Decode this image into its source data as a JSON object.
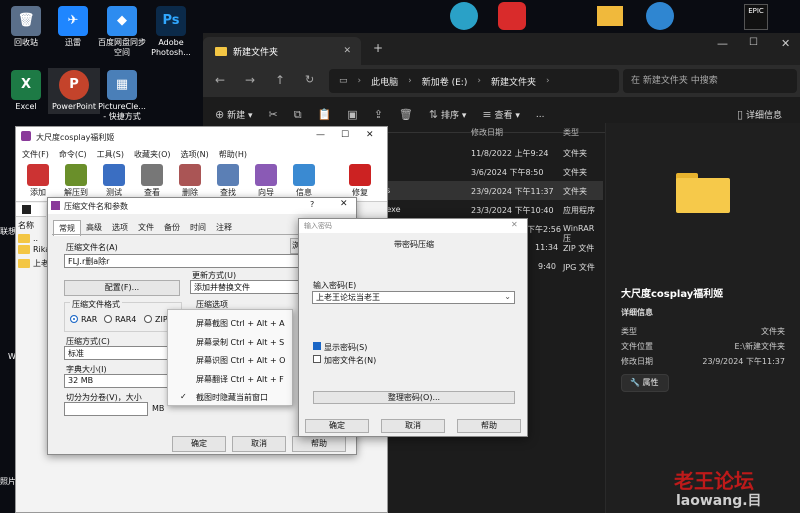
{
  "desktop": {
    "icons": [
      {
        "label": "回收站",
        "glyph": "🗑",
        "color": "#5a6f8a"
      },
      {
        "label": "迅雷",
        "glyph": "✈",
        "color": "#1f86ff"
      },
      {
        "label": "百度网盘同步空间",
        "glyph": "◆",
        "color": "#2d8cf0"
      },
      {
        "label": "Adobe Photosh...",
        "glyph": "Ps",
        "color": "#0b2a49"
      },
      {
        "label": "Excel",
        "glyph": "X",
        "color": "#1d7a45"
      },
      {
        "label": "PowerPoint",
        "glyph": "P",
        "color": "#c4432b"
      },
      {
        "label": "PictureCle... - 快捷方式",
        "glyph": "▦",
        "color": "#4a7fb8"
      }
    ],
    "partial_labels": [
      "联想",
      "W",
      "照片"
    ]
  },
  "explorer": {
    "tab_title": "新建文件夹",
    "breadcrumb": [
      "此电脑",
      "新加卷 (E:)",
      "新建文件夹"
    ],
    "search_placeholder": "在 新建文件夹 中搜索",
    "toolbar": {
      "new": "新建",
      "sort": "排序",
      "view": "查看",
      "more": "...",
      "details": "详细信息"
    },
    "columns": {
      "date": "修改日期",
      "type": "类型"
    },
    "rows": [
      {
        "name": "",
        "date": "11/8/2022 上午9:24",
        "type": "文件夹"
      },
      {
        "name": "",
        "date": "3/6/2024 下午8:50",
        "type": "文件夹"
      },
      {
        "name": "s",
        "date": "23/9/2024 下午11:37",
        "type": "文件夹"
      },
      {
        "name": "aller.exe",
        "date": "23/3/2024 下午10:40",
        "type": "应用程序"
      },
      {
        "name": "",
        "date": "下午2:56",
        "type": "WinRAR 压"
      },
      {
        "name": "",
        "date": "11:34",
        "type": "ZIP 文件"
      },
      {
        "name": "",
        "date": "9:40",
        "type": "JPG 文件"
      }
    ],
    "details_pane": {
      "title": "大尺度cosplay福利姬",
      "section": "详细信息",
      "fields": [
        {
          "key": "类型",
          "value": "文件夹"
        },
        {
          "key": "文件位置",
          "value": "E:\\新建文件夹"
        },
        {
          "key": "修改日期",
          "value": "23/9/2024 下午11:37"
        }
      ],
      "properties_button": "属性"
    }
  },
  "winrar": {
    "title": "大尺度cosplay福利姬",
    "menu": [
      "文件(F)",
      "命令(C)",
      "工具(S)",
      "收藏夹(O)",
      "选项(N)",
      "帮助(H)"
    ],
    "tools": [
      {
        "label": "添加",
        "color": "#c33"
      },
      {
        "label": "解压到",
        "color": "#6a8f2a"
      },
      {
        "label": "测试",
        "color": "#3a6ec2"
      },
      {
        "label": "查看",
        "color": "#777"
      },
      {
        "label": "删除",
        "color": "#a55"
      },
      {
        "label": "查找",
        "color": "#5b7fb5"
      },
      {
        "label": "向导",
        "color": "#8a5ab5"
      },
      {
        "label": "信息",
        "color": "#3a8ad2"
      },
      {
        "label": "修复",
        "color": "#c22"
      }
    ],
    "list_header": "名称",
    "list_items": [
      "..",
      "Rikac",
      "上老王"
    ]
  },
  "compress": {
    "title": "压缩文件名和参数",
    "help_mark": "?",
    "tabs": [
      "常规",
      "高级",
      "选项",
      "文件",
      "备份",
      "时间",
      "注释"
    ],
    "archive_name_label": "压缩文件名(A)",
    "archive_name_value": "FLJ.r删a除r",
    "browse_button": "浏",
    "profile_button": "配置(F)...",
    "update_mode_label": "更新方式(U)",
    "update_mode_value": "添加并替换文件",
    "format_label": "压缩文件格式",
    "formats": [
      "RAR",
      "RAR4",
      "ZIP"
    ],
    "options_label": "压缩选项",
    "method_label": "压缩方式(C)",
    "method_value": "标准",
    "dict_label": "字典大小(I)",
    "dict_value": "32 MB",
    "split_label": "切分为分卷(V)，大小",
    "split_unit": "MB",
    "ok": "确定",
    "cancel": "取消",
    "help": "帮助"
  },
  "context_menu": {
    "items": [
      "屏幕截图 Ctrl + Alt + A",
      "屏幕录制 Ctrl + Alt + S",
      "屏幕识图 Ctrl + Alt + O",
      "屏幕翻译 Ctrl + Alt + F",
      "截图时隐藏当前窗口"
    ],
    "check_mark": "✓"
  },
  "password": {
    "title": "输入密码",
    "heading": "带密码压缩",
    "input_label": "输入密码(E)",
    "input_value": "上老王论坛当老王",
    "show_password": "显示密码(S)",
    "encrypt_names": "加密文件名(N)",
    "organize_button": "整理密码(O)...",
    "ok": "确定",
    "cancel": "取消",
    "help": "帮助"
  },
  "watermark": {
    "line1": "老王论坛",
    "line2": "laowang.目"
  }
}
